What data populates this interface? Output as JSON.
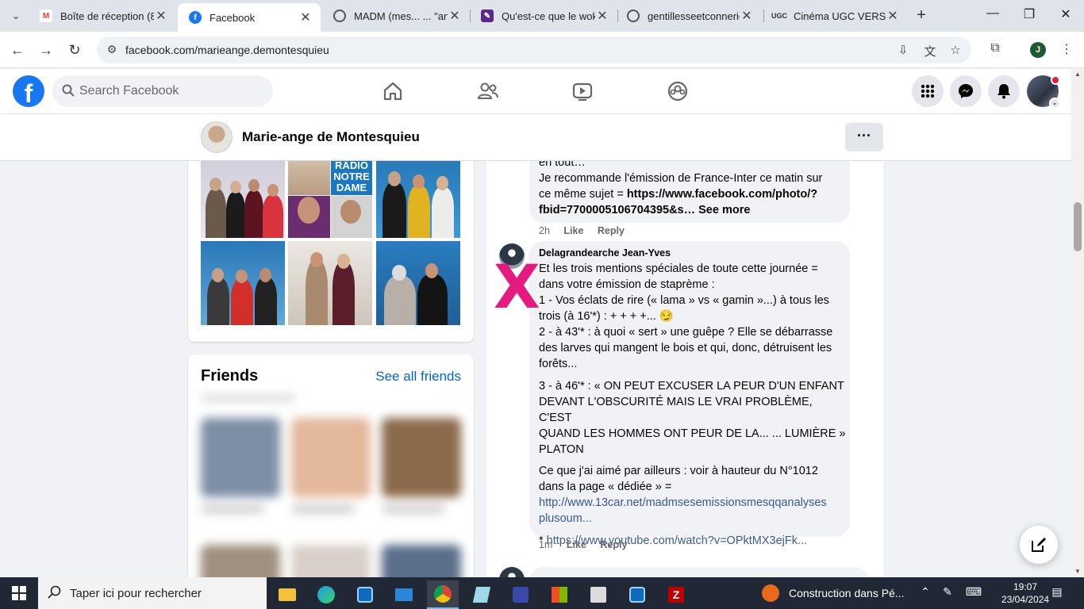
{
  "browser": {
    "tabs": [
      {
        "title": "Boîte de réception (8",
        "icon": "gmail-icon",
        "active": false
      },
      {
        "title": "Facebook",
        "icon": "facebook-icon",
        "active": true
      },
      {
        "title": "MADM (mes... ... \"an",
        "icon": "globe-icon",
        "active": false
      },
      {
        "title": "Qu'est-ce que le wok",
        "icon": "wok-icon",
        "active": false
      },
      {
        "title": "gentillesseetconnerie",
        "icon": "globe-icon",
        "active": false
      },
      {
        "title": "Cinéma UGC VERSAI",
        "icon": "ugc-icon",
        "active": false
      }
    ],
    "url": "facebook.com/marieange.demontesquieu",
    "profile_initial": "J"
  },
  "facebook": {
    "search_placeholder": "Search Facebook",
    "profile_name": "Marie-ange de Montesquieu",
    "more_label": "···",
    "brand_color": "#1877f2",
    "friends": {
      "title": "Friends",
      "see_all": "See all friends"
    }
  },
  "comments": [
    {
      "text_lines_1": [
        "en tout…",
        "Je recommande l'émission de France-Inter ce matin sur",
        "ce même sujet = "
      ],
      "link_bold": "https://www.facebook.com/photo/?",
      "link_bold_2": "fbid=7700005106704395&s…",
      "see_more": "See more",
      "time": "2h",
      "like": "Like",
      "reply": "Reply"
    },
    {
      "author": "Delagrandearche Jean-Yves",
      "para1": [
        "Et les trois mentions spéciales de toute cette journée =",
        "dans votre émission de staprème :",
        "1 - Vos éclats de rire (« lama » vs « gamin »...) à tous les",
        "trois (à 16'*) : + + + +... 😏",
        "2 - à 43'* : à quoi « sert » une guêpe ? Elle se débarrasse",
        "des larves qui mangent le bois et qui, donc, détruisent les",
        "forêts..."
      ],
      "para2": [
        "3 - à 46'* : « ON PEUT EXCUSER LA PEUR D'UN ENFANT",
        "DEVANT L'OBSCURITÉ MAIS LE VRAI PROBLÈME, C'EST",
        "QUAND LES HOMMES ONT PEUR DE LA... ... LUMIÈRE »",
        "PLATON"
      ],
      "para3": [
        "Ce que j'ai aimé par ailleurs : voir à hauteur du N°1012",
        "dans la page « dédiée » ="
      ],
      "link3": [
        "http://www.13car.net/madmsesemissionsmesqqanalyses",
        "plusoum..."
      ],
      "para4_prefix": "* ",
      "link4": "https://www.youtube.com/watch?v=OPktMX3ejFk...",
      "time": "1m",
      "like": "Like",
      "reply": "Reply"
    }
  ],
  "annotation_mark": "X",
  "taskbar": {
    "search_text": "Taper ici pour rechercher",
    "news_text": "Construction dans Pé...",
    "time": "19:07",
    "date": "23/04/2024"
  }
}
